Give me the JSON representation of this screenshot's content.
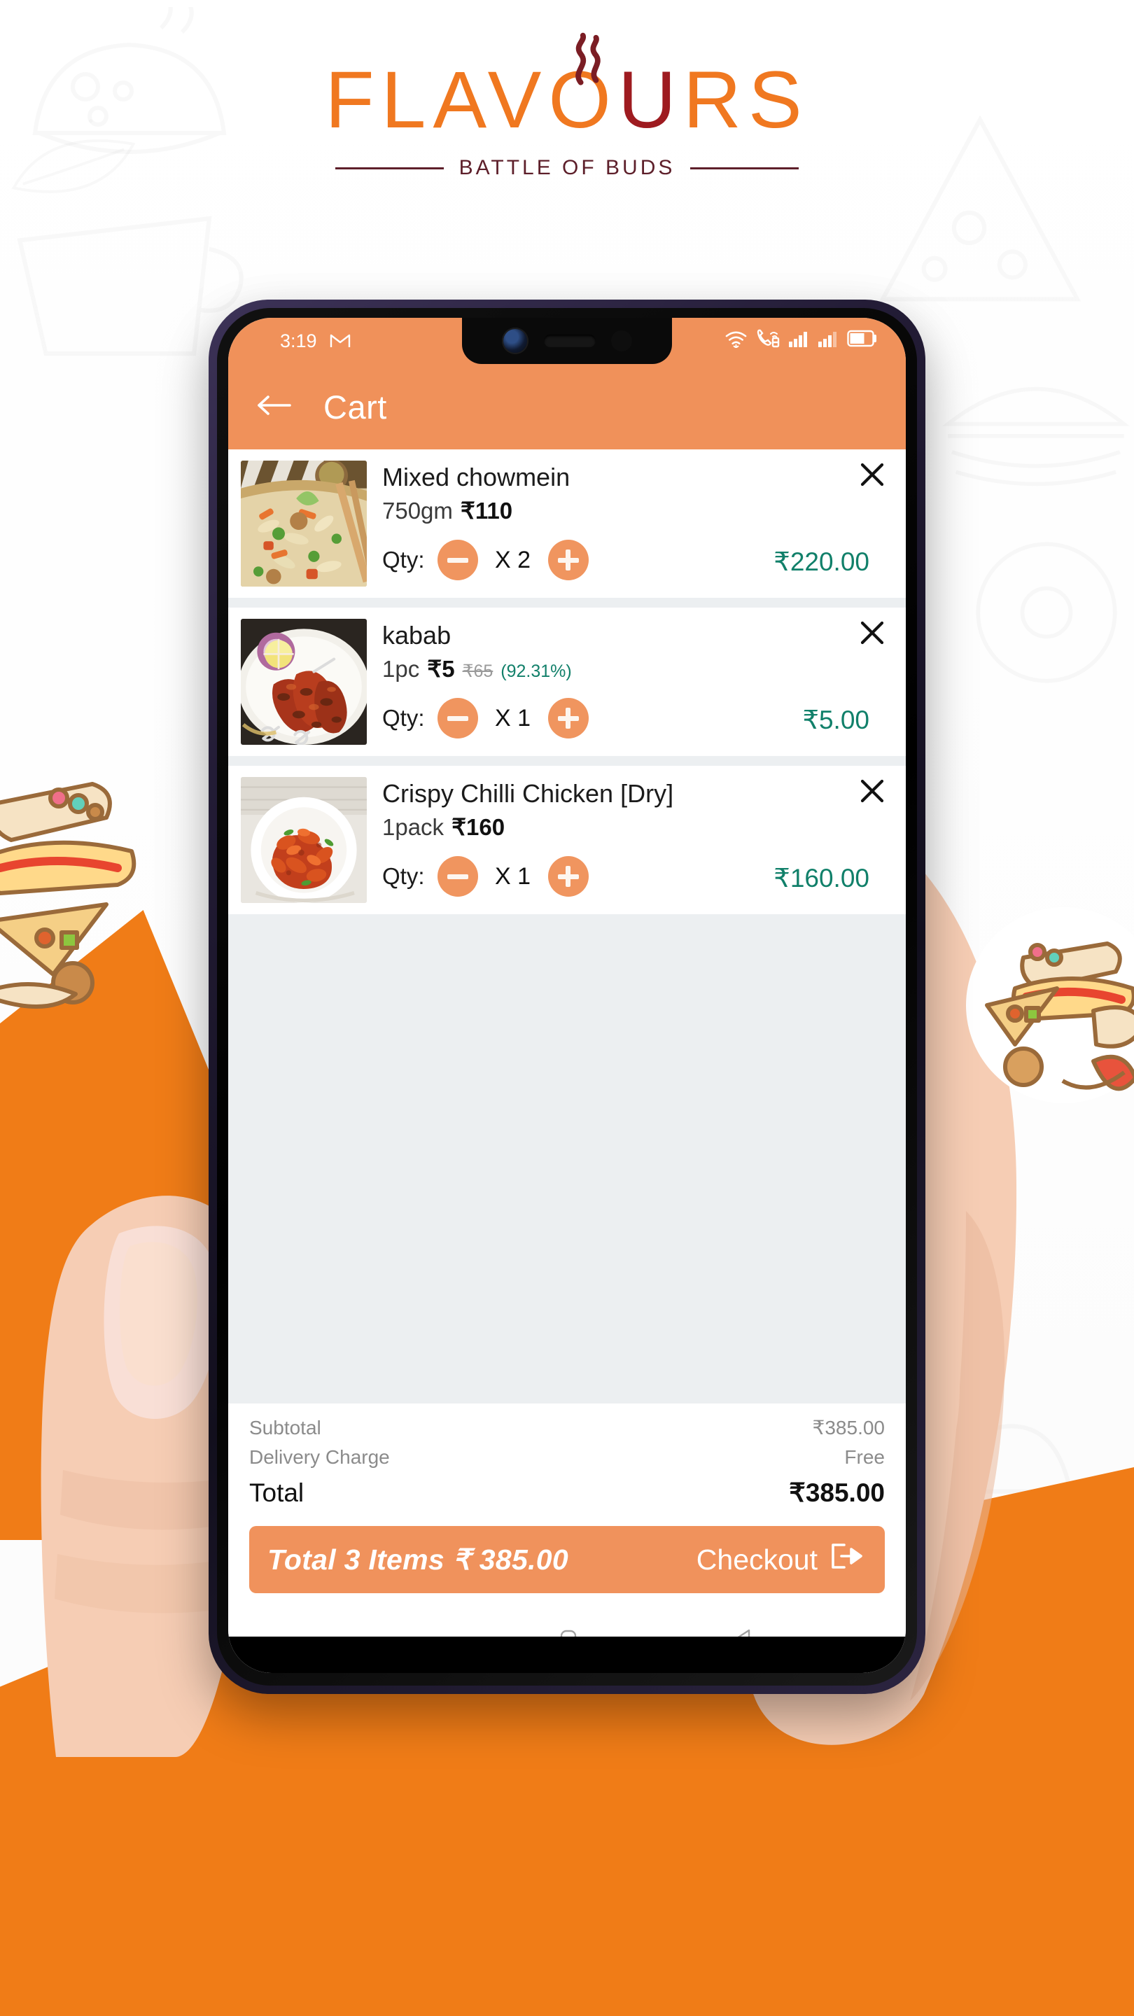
{
  "brand": {
    "name_part1": "FLAVO",
    "name_u": "U",
    "name_part2": "RS",
    "tagline": "BATTLE OF BUDS",
    "orange": "#f07820",
    "maroon": "#9e1b20"
  },
  "phone": {
    "statusbar": {
      "time": "3:19",
      "gmail_icon": "gmail-icon",
      "wifi_icon": "wifi-icon",
      "call_icon": "call-signal-icon",
      "sim1_icon": "signal-bars-icon",
      "sim2_icon": "signal-bars-icon",
      "battery_icon": "battery-icon"
    },
    "appbar": {
      "back_icon": "arrow-left-icon",
      "title": "Cart"
    },
    "cart": {
      "items": [
        {
          "name": "Mixed chowmein",
          "unit": "750gm",
          "price": "₹110",
          "old_price": "",
          "discount": "",
          "qty_label": "Qty:",
          "qty": "X 2",
          "line_total": "₹220.00",
          "thumb": "mixed-chowmein-photo"
        },
        {
          "name": "kabab",
          "unit": "1pc",
          "price": "₹5",
          "old_price": "₹65",
          "discount": "(92.31%)",
          "qty_label": "Qty:",
          "qty": "X 1",
          "line_total": "₹5.00",
          "thumb": "kabab-photo"
        },
        {
          "name": "Crispy Chilli Chicken [Dry]",
          "unit": "1pack",
          "price": "₹160",
          "old_price": "",
          "discount": "",
          "qty_label": "Qty:",
          "qty": "X 1",
          "line_total": "₹160.00",
          "thumb": "crispy-chilli-chicken-photo"
        }
      ]
    },
    "summary": {
      "subtotal_label": "Subtotal",
      "subtotal_value": "₹385.00",
      "delivery_label": "Delivery Charge",
      "delivery_value": "Free",
      "total_label": "Total",
      "total_value": "₹385.00"
    },
    "checkout": {
      "left_text": "Total 3 Items ₹ 385.00",
      "button_label": "Checkout",
      "button_icon": "sign-out-arrow-icon"
    },
    "navbar": {
      "recents_icon": "recents-icon",
      "home_icon": "home-icon",
      "back_icon": "back-triangle-icon"
    }
  },
  "colors": {
    "accent_orange": "#f0915a",
    "price_green": "#11806a",
    "screen_bg": "#eceff1",
    "card_bg": "#ffffff"
  }
}
